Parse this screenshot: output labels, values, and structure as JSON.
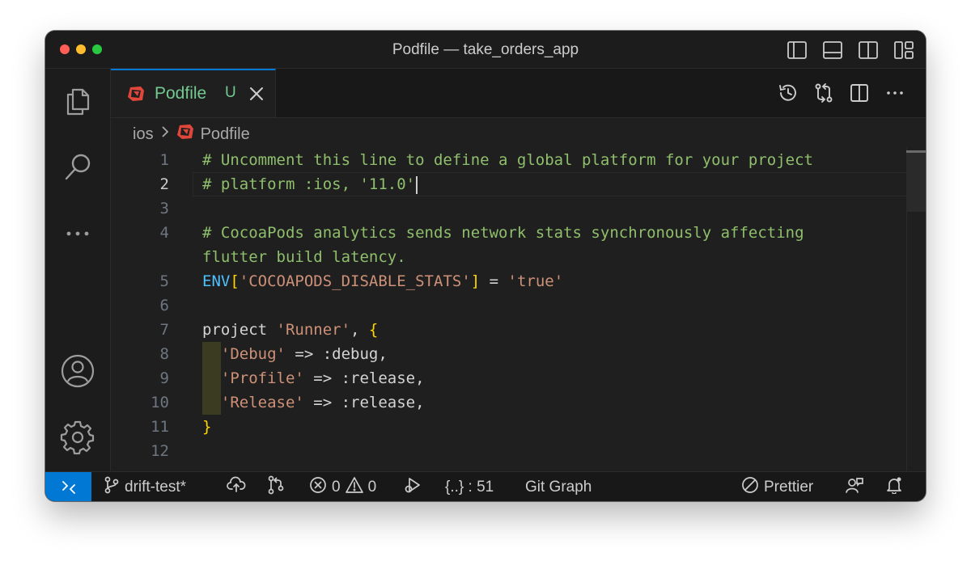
{
  "window": {
    "title": "Podfile — take_orders_app"
  },
  "tab": {
    "label": "Podfile",
    "badge": "U"
  },
  "breadcrumb": {
    "folder": "ios",
    "file": "Podfile"
  },
  "editor": {
    "active_line": 2,
    "lines": [
      {
        "num": "1",
        "segments": [
          {
            "cls": "c-comment",
            "text": "# Uncomment this line to define a global platform for your project"
          }
        ]
      },
      {
        "num": "2",
        "segments": [
          {
            "cls": "c-comment",
            "text": "# platform :ios, '11.0'"
          }
        ]
      },
      {
        "num": "3",
        "segments": []
      },
      {
        "num": "4",
        "segments": [
          {
            "cls": "c-comment",
            "text": "# CocoaPods analytics sends network stats synchronously affecting"
          }
        ]
      },
      {
        "num": "",
        "segments": [
          {
            "cls": "c-comment",
            "text": "flutter build latency."
          }
        ]
      },
      {
        "num": "5",
        "segments": [
          {
            "cls": "c-const",
            "text": "ENV"
          },
          {
            "cls": "c-bracket",
            "text": "["
          },
          {
            "cls": "c-string",
            "text": "'COCOAPODS_DISABLE_STATS'"
          },
          {
            "cls": "c-bracket",
            "text": "]"
          },
          {
            "cls": "c-text",
            "text": " = "
          },
          {
            "cls": "c-string",
            "text": "'true'"
          }
        ]
      },
      {
        "num": "6",
        "segments": []
      },
      {
        "num": "7",
        "segments": [
          {
            "cls": "c-text",
            "text": "project "
          },
          {
            "cls": "c-string",
            "text": "'Runner'"
          },
          {
            "cls": "c-text",
            "text": ", "
          },
          {
            "cls": "c-bracket",
            "text": "{"
          }
        ]
      },
      {
        "num": "8",
        "segments": [
          {
            "cls": "c-text",
            "text": "  "
          },
          {
            "cls": "c-string",
            "text": "'Debug'"
          },
          {
            "cls": "c-text",
            "text": " => :debug,"
          }
        ]
      },
      {
        "num": "9",
        "segments": [
          {
            "cls": "c-text",
            "text": "  "
          },
          {
            "cls": "c-string",
            "text": "'Profile'"
          },
          {
            "cls": "c-text",
            "text": " => :release,"
          }
        ]
      },
      {
        "num": "10",
        "segments": [
          {
            "cls": "c-text",
            "text": "  "
          },
          {
            "cls": "c-string",
            "text": "'Release'"
          },
          {
            "cls": "c-text",
            "text": " => :release,"
          }
        ]
      },
      {
        "num": "11",
        "segments": [
          {
            "cls": "c-bracket",
            "text": "}"
          }
        ]
      },
      {
        "num": "12",
        "segments": []
      }
    ]
  },
  "statusbar": {
    "branch": "drift-test*",
    "errors": "0",
    "warnings": "0",
    "json_path": "{..} : 51",
    "git_graph": "Git Graph",
    "prettier": "Prettier"
  },
  "colors": {
    "accent": "#0078d4",
    "untracked": "#73c991",
    "ruby": "#e0473a"
  },
  "icons": {
    "activity": [
      "files-icon",
      "search-icon",
      "more-icon",
      "account-icon",
      "settings-gear-icon"
    ],
    "title_layout": [
      "toggle-primary-sidebar-icon",
      "toggle-panel-icon",
      "toggle-secondary-sidebar-icon",
      "customize-layout-icon"
    ],
    "editor_actions": [
      "timeline-history-icon",
      "compare-changes-icon",
      "split-editor-icon",
      "more-actions-icon"
    ]
  }
}
